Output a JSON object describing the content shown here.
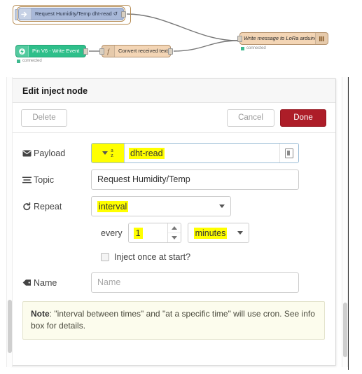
{
  "flow": {
    "nodes": [
      {
        "id": "inject",
        "label": "Request Humidity/Temp dht-read ↺",
        "icon": "inject-arrow-icon",
        "selected": true,
        "type": "inject"
      },
      {
        "id": "pin",
        "label": "Pin V6 - Write Event",
        "icon": "blynk-icon",
        "status": "connected",
        "type": "blynk-in"
      },
      {
        "id": "func",
        "label": "Convert received text",
        "icon": "function-f-icon",
        "type": "function"
      },
      {
        "id": "lora",
        "label": "Write message to LoRa arduino",
        "icon": "serial-port-icon",
        "status": "connected",
        "type": "serial-out"
      }
    ],
    "status_label": "connected"
  },
  "dialog": {
    "title": "Edit inject node",
    "buttons": {
      "delete": "Delete",
      "cancel": "Cancel",
      "done": "Done"
    },
    "accent_color": "#ad1d28",
    "highlight_color": "#ffff00",
    "fields": {
      "payload": {
        "label": "Payload",
        "icon": "envelope-icon",
        "type_icon": "string-az-icon",
        "type_top": "a",
        "type_bottom": "z",
        "value": "dht-read",
        "expand_icon": "expand-editor-icon"
      },
      "topic": {
        "label": "Topic",
        "icon": "list-lines-icon",
        "value": "Request Humidity/Temp"
      },
      "repeat": {
        "label": "Repeat",
        "icon": "refresh-icon",
        "value": "interval"
      },
      "every": {
        "label": "every",
        "count": "1",
        "units": "minutes"
      },
      "once": {
        "label": "Inject once at start?",
        "checked": false
      },
      "name": {
        "label": "Name",
        "icon": "tag-icon",
        "value": "",
        "placeholder": "Name"
      }
    },
    "note": {
      "prefix": "Note",
      "text": ": \"interval between times\" and \"at a specific time\" will use cron. See info box for details."
    }
  }
}
